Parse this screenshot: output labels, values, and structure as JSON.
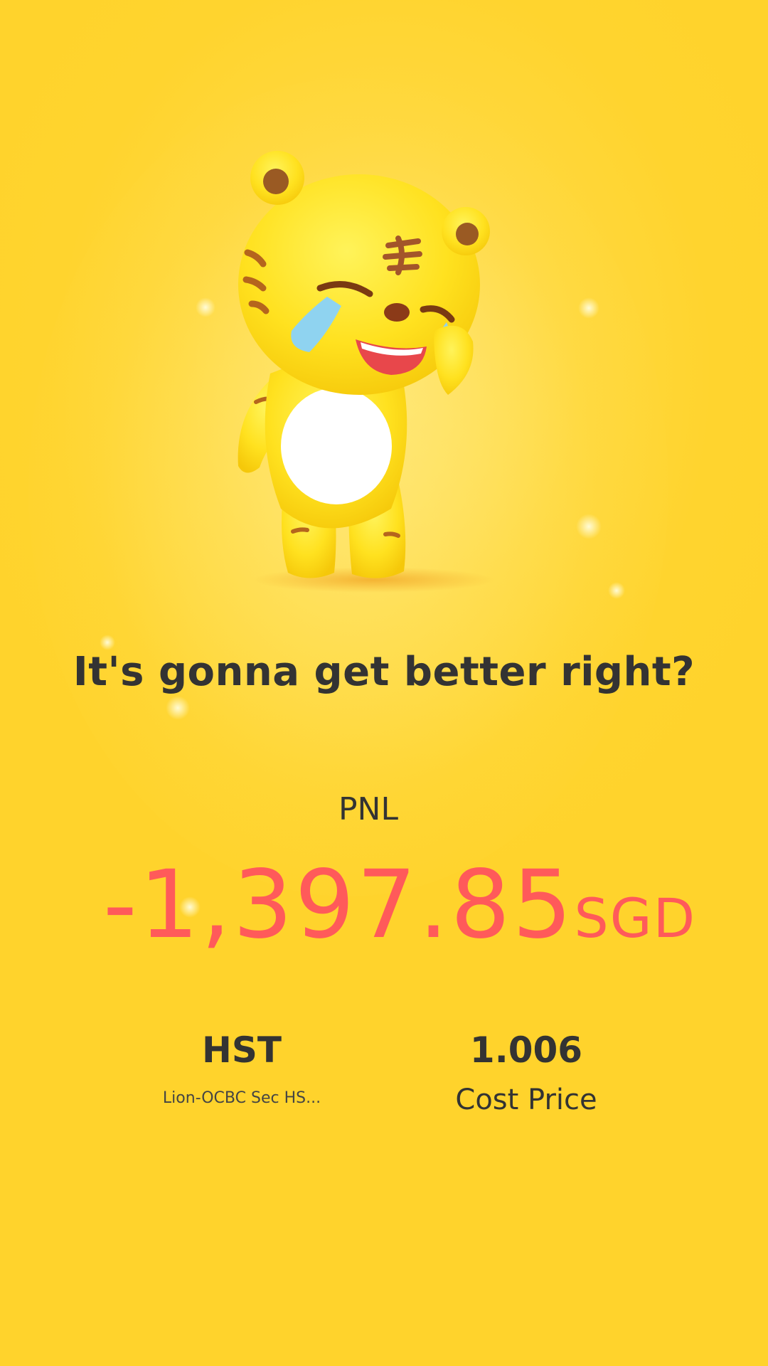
{
  "headline": "It's gonna get better right?",
  "pnl": {
    "label": "PNL",
    "value": "-1,397.85",
    "currency": "SGD",
    "color": "#ff5a5a"
  },
  "stats": {
    "symbol": "HST",
    "name": "Lion-OCBC Sec HS...",
    "cost_price_value": "1.006",
    "cost_price_label": "Cost Price"
  },
  "mascot": {
    "icon": "crying-tiger-mascot-icon"
  },
  "colors": {
    "background": "#ffd83d",
    "text": "#333333",
    "loss": "#ff5a5a"
  }
}
